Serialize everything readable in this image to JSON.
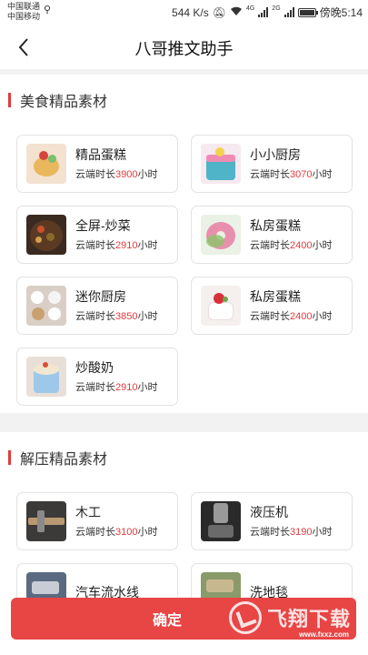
{
  "status": {
    "carrier1": "中国联通",
    "carrier2": "中国移动",
    "speed": "544 K/s",
    "net1": "4G",
    "net2": "2G",
    "time": "傍晚5:14"
  },
  "header": {
    "title": "八哥推文助手"
  },
  "colors": {
    "accent": "#e4393c",
    "button": "#e84545"
  },
  "sections": [
    {
      "title": "美食精品素材",
      "items": [
        {
          "name": "精品蛋糕",
          "prefix": "云端时长",
          "hours": "3900",
          "suffix": "小时",
          "icon": "cake-photo"
        },
        {
          "name": "小小厨房",
          "prefix": "云端时长",
          "hours": "3070",
          "suffix": "小时",
          "icon": "layer-cake-photo"
        },
        {
          "name": "全屏-炒菜",
          "prefix": "云端时长",
          "hours": "2910",
          "suffix": "小时",
          "icon": "stir-fry-photo"
        },
        {
          "name": "私房蛋糕",
          "prefix": "云端时长",
          "hours": "2400",
          "suffix": "小时",
          "icon": "donut-photo"
        },
        {
          "name": "迷你厨房",
          "prefix": "云端时长",
          "hours": "3850",
          "suffix": "小时",
          "icon": "mini-kitchen-photo"
        },
        {
          "name": "私房蛋糕",
          "prefix": "云端时长",
          "hours": "2400",
          "suffix": "小时",
          "icon": "strawberry-cake-photo"
        },
        {
          "name": "炒酸奶",
          "prefix": "云端时长",
          "hours": "2910",
          "suffix": "小时",
          "icon": "yogurt-photo"
        }
      ]
    },
    {
      "title": "解压精品素材",
      "items": [
        {
          "name": "木工",
          "prefix": "云端时长",
          "hours": "3100",
          "suffix": "小时",
          "icon": "woodwork-photo"
        },
        {
          "name": "液压机",
          "prefix": "云端时长",
          "hours": "3190",
          "suffix": "小时",
          "icon": "hydraulic-press-photo"
        },
        {
          "name": "汽车流水线",
          "icon": "car-line-photo"
        },
        {
          "name": "洗地毯",
          "icon": "carpet-photo"
        }
      ]
    }
  ],
  "confirm_label": "确定",
  "watermark": {
    "text": "飞翔下载",
    "sub": "www.fxxz.com"
  }
}
